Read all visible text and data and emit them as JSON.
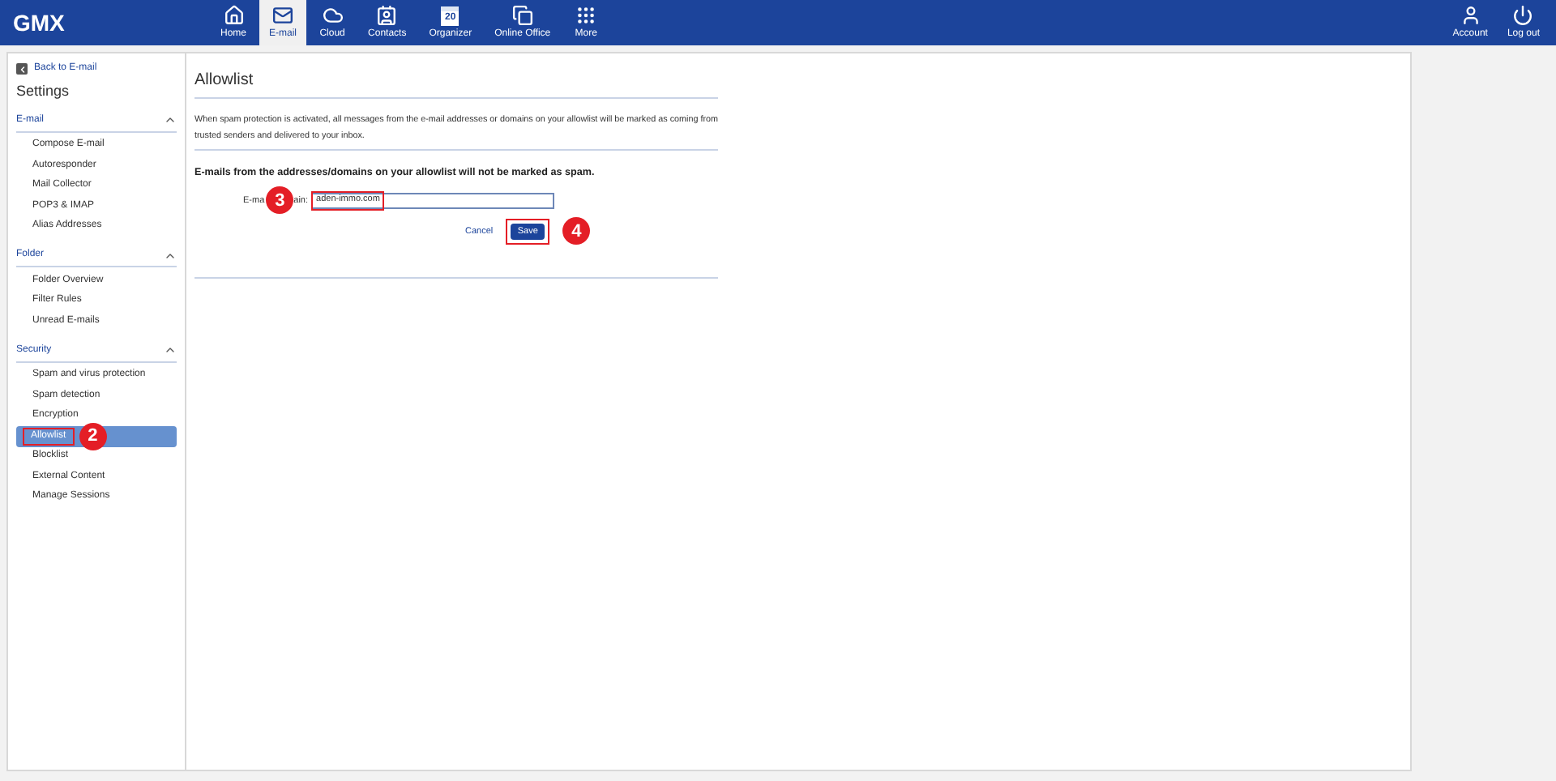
{
  "logo": "GMX",
  "nav": [
    {
      "label": "Home",
      "selected": false
    },
    {
      "label": "E-mail",
      "selected": true
    },
    {
      "label": "Cloud",
      "selected": false
    },
    {
      "label": "Contacts",
      "selected": false
    },
    {
      "label": "Organizer",
      "selected": false,
      "icon_text": "20"
    },
    {
      "label": "Online Office",
      "selected": false
    },
    {
      "label": "More",
      "selected": false
    }
  ],
  "nav_right": [
    {
      "label": "Account"
    },
    {
      "label": "Log out"
    }
  ],
  "sidebar": {
    "back": "Back to E-mail",
    "title": "Settings",
    "sections": [
      {
        "title": "E-mail",
        "expanded": true,
        "items": [
          {
            "label": "Compose E-mail",
            "selected": false
          },
          {
            "label": "Autoresponder",
            "selected": false
          },
          {
            "label": "Mail Collector",
            "selected": false
          },
          {
            "label": "POP3 & IMAP",
            "selected": false
          },
          {
            "label": "Alias Addresses",
            "selected": false
          }
        ]
      },
      {
        "title": "Folder",
        "expanded": true,
        "items": [
          {
            "label": "Folder Overview",
            "selected": false
          },
          {
            "label": "Filter Rules",
            "selected": false
          },
          {
            "label": "Unread E-mails",
            "selected": false
          }
        ]
      },
      {
        "title": "Security",
        "expanded": true,
        "items": [
          {
            "label": "Spam and virus protection",
            "selected": false
          },
          {
            "label": "Spam detection",
            "selected": false
          },
          {
            "label": "Encryption",
            "selected": false
          },
          {
            "label": "Allowlist",
            "selected": true,
            "annotation": "2"
          },
          {
            "label": "Blocklist",
            "selected": false
          },
          {
            "label": "External Content",
            "selected": false
          },
          {
            "label": "Manage Sessions",
            "selected": false
          }
        ]
      }
    ]
  },
  "main": {
    "title": "Allowlist",
    "description": "When spam protection is activated, all messages from the e-mail addresses or domains on your allowlist will be marked as coming from trusted senders and delivered to your inbox.",
    "heading": "E-mails from the addresses/domains on your allowlist will not be marked as spam.",
    "field": {
      "label_start": "E-ma",
      "label_end": "ain:",
      "value": "aden-immo.com",
      "annotation": "3"
    },
    "cancel": "Cancel",
    "save": {
      "label": "Save",
      "annotation": "4"
    }
  }
}
